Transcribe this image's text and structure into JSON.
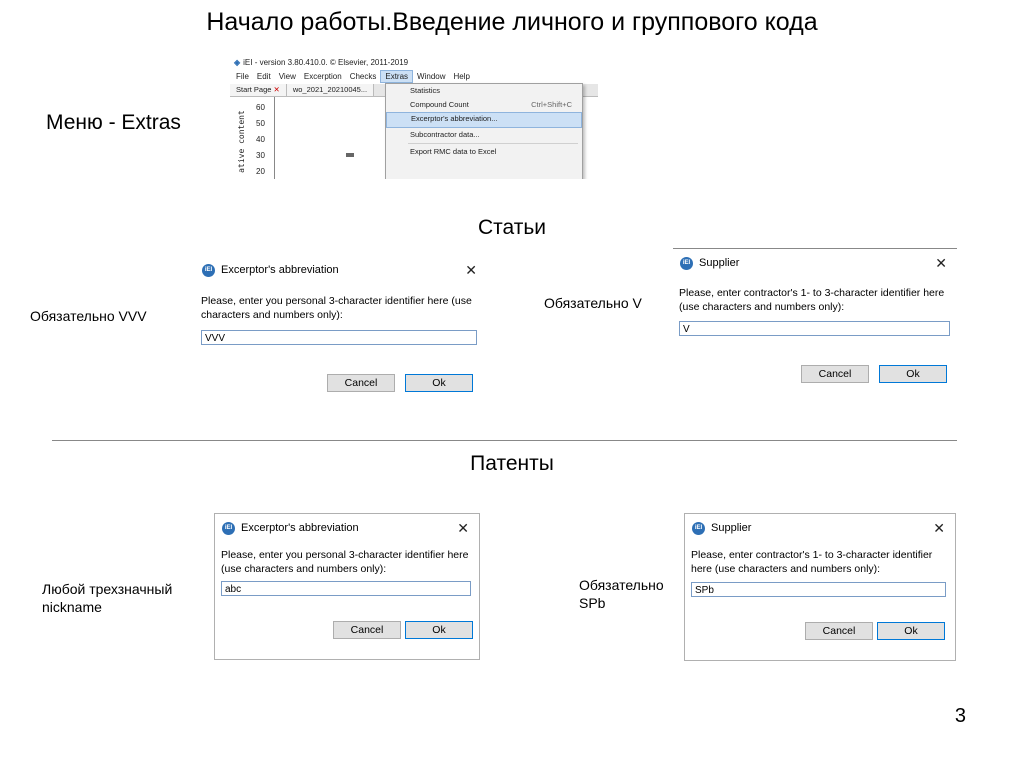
{
  "slide": {
    "title": "Начало работы.Введение личного и группового кода",
    "menu_label": "Меню - Extras",
    "articles_heading": "Статьи",
    "patents_heading": "Патенты",
    "page_number": "3"
  },
  "app": {
    "window_title": "iEI - version 3.80.410.0. © Elsevier, 2011-2019",
    "menu": [
      "File",
      "Edit",
      "View",
      "Excerption",
      "Checks",
      "Extras",
      "Window",
      "Help"
    ],
    "tabs": [
      "Start Page",
      "wo_2021_20210045..."
    ],
    "tab_close": "✕",
    "chart_ylabel": "ative content",
    "chart_yticks": [
      "60",
      "50",
      "40",
      "30",
      "20"
    ],
    "extras_menu": [
      {
        "label": "Statistics",
        "shortcut": ""
      },
      {
        "label": "Compound Count",
        "shortcut": "Ctrl+Shift+C"
      },
      {
        "label": "Excerptor's abbreviation...",
        "shortcut": ""
      },
      {
        "label": "Subcontractor data...",
        "shortcut": ""
      },
      {
        "label": "Export RMC data to Excel",
        "shortcut": ""
      }
    ]
  },
  "notes": {
    "articles_excerptor": "Обязательно VVV",
    "articles_supplier": "Обязательно V",
    "patents_excerptor": "Любой трехзначный nickname",
    "patents_supplier": "Обязательно SPb"
  },
  "dialogs": {
    "excerptor_title": "Excerptor's abbreviation",
    "excerptor_prompt": "Please, enter you personal 3-character identifier here (use characters and numbers only):",
    "supplier_title": "Supplier",
    "supplier_prompt": "Please, enter contractor's 1- to 3-character identifier here (use characters and numbers only):",
    "cancel_label": "Cancel",
    "ok_label": "Ok",
    "close_glyph": "✕",
    "logo_text": "iEI",
    "values": {
      "articles_excerptor": "VVV",
      "articles_supplier": "V",
      "patents_excerptor": "abc",
      "patents_supplier": "SPb"
    }
  }
}
